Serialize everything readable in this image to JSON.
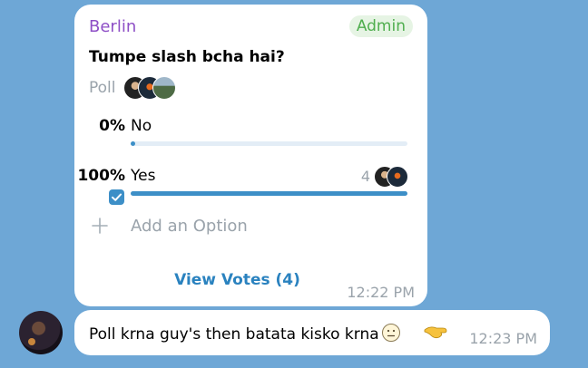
{
  "poll_message": {
    "sender": "Berlin",
    "badge": "Admin",
    "question": "Tumpe slash bcha hai?",
    "poll_type": "Poll",
    "options": [
      {
        "percent": "0%",
        "label": "No",
        "fraction": 0.0,
        "count": "",
        "selected": false
      },
      {
        "percent": "100%",
        "label": "Yes",
        "fraction": 1.0,
        "count": "4",
        "selected": true
      }
    ],
    "add_option_label": "Add an Option",
    "view_votes_label": "View Votes (4)",
    "time": "12:22 PM"
  },
  "text_message": {
    "text": "Poll krna guy's then batata kisko krna",
    "time": "12:23 PM"
  },
  "colors": {
    "background": "#6ea7d6",
    "sender": "#8e4fc6",
    "admin": "#4fae4e",
    "accent": "#3d8fc7",
    "meta": "#9aa3ab"
  }
}
